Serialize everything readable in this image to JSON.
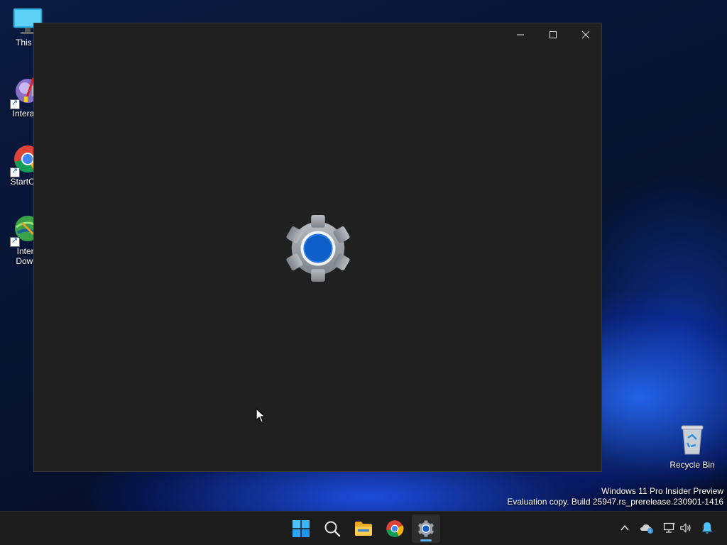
{
  "desktop": {
    "icons": [
      {
        "label": "This P",
        "icon": "monitor-icon"
      },
      {
        "label": "Interacti",
        "icon": "interactive-app-icon"
      },
      {
        "label": "StartCurr",
        "icon": "chrome-icon"
      },
      {
        "label_line1": "Intern",
        "label_line2": "Downl",
        "icon": "internet-download-manager-icon"
      }
    ],
    "recycle_bin": {
      "label": "Recycle Bin",
      "icon": "recycle-bin-icon"
    }
  },
  "window": {
    "app": "Settings",
    "splash_icon": "settings-gear-icon",
    "controls": {
      "minimize": "minimize-icon",
      "maximize": "maximize-icon",
      "close": "close-icon"
    }
  },
  "watermark": {
    "line1": "Windows 11 Pro Insider Preview",
    "line2": "Evaluation copy. Build 25947.rs_prerelease.230901-1416"
  },
  "taskbar": {
    "items": [
      "start-icon",
      "search-icon",
      "file-explorer-icon",
      "chrome-icon",
      "settings-icon"
    ],
    "active": "settings-icon",
    "tray": [
      "chevron-up-icon",
      "onedrive-icon",
      "network-icon",
      "volume-icon",
      "notification-bell-icon"
    ]
  },
  "colors": {
    "accent": "#0f5fc9",
    "window_bg": "#202020",
    "taskbar_bg": "#1c1c1c",
    "active_indicator": "#5fb2f2"
  }
}
